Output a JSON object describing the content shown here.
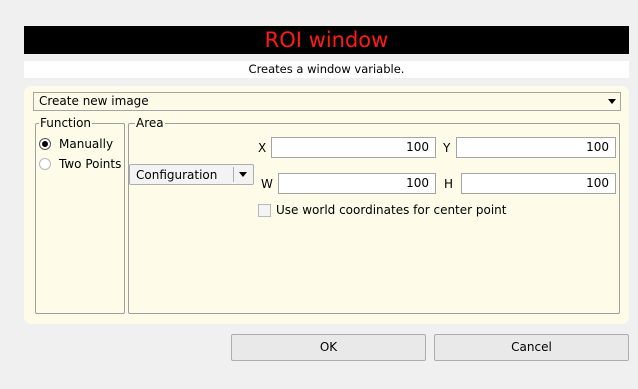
{
  "window": {
    "title": "ROI window",
    "subtitle": "Creates a window variable."
  },
  "mode_select": {
    "value": "Create new image"
  },
  "function_group": {
    "legend": "Function",
    "options": [
      {
        "label": "Manually",
        "checked": true
      },
      {
        "label": "Two Points",
        "checked": false
      }
    ]
  },
  "area_group": {
    "legend": "Area",
    "configuration_label": "Configuration",
    "x_label": "X",
    "x_value": "100",
    "y_label": "Y",
    "y_value": "100",
    "w_label": "W",
    "w_value": "100",
    "h_label": "H",
    "h_value": "100",
    "world_coords_label": "Use world coordinates for center point",
    "world_coords_checked": false
  },
  "buttons": {
    "ok": "OK",
    "cancel": "Cancel"
  },
  "colors": {
    "title_bg": "#000000",
    "title_text": "#ff1a1a",
    "panel_bg": "#fefce8"
  },
  "icons": {
    "dropdown": "chevron-down-icon"
  }
}
